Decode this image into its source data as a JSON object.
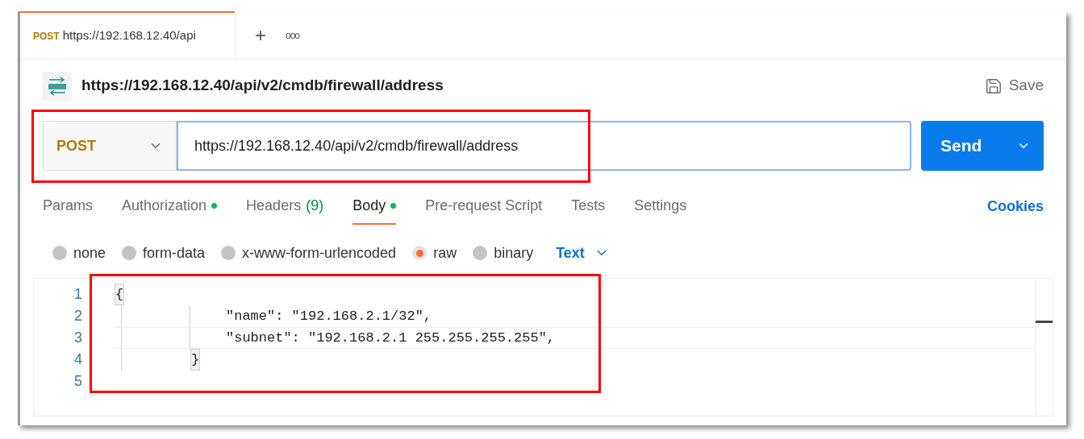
{
  "tab": {
    "method": "POST",
    "url": "https://192.168.12.40/api",
    "selected": true
  },
  "tab_actions": [
    "+",
    "ooo"
  ],
  "request": {
    "title": "https://192.168.12.40/api/v2/cmdb/firewall/address",
    "save": "Save"
  },
  "url_bar": {
    "method": "POST",
    "url": "https://192.168.12.40/api/v2/cmdb/firewall/address",
    "send": "Send",
    "highlighted": true
  },
  "request_tabs": [
    {
      "label": "Params",
      "selected": false,
      "dot": false
    },
    {
      "label": "Authorization",
      "selected": false,
      "dot": true
    },
    {
      "label": "Headers",
      "count": "(9)",
      "selected": false,
      "dot": false
    },
    {
      "label": "Body",
      "selected": true,
      "dot": true
    },
    {
      "label": "Pre-request Script",
      "selected": false,
      "dot": false
    },
    {
      "label": "Tests",
      "selected": false,
      "dot": false
    },
    {
      "label": "Settings",
      "selected": false,
      "dot": false
    }
  ],
  "cookies": "Cookies",
  "body_types": [
    {
      "label": "none",
      "selected": false
    },
    {
      "label": "form-data",
      "selected": false
    },
    {
      "label": "x-www-form-urlencoded",
      "selected": false
    },
    {
      "label": "raw",
      "selected": true
    },
    {
      "label": "binary",
      "selected": false
    }
  ],
  "format": "Text",
  "editor": {
    "highlighted": true,
    "lines": [
      {
        "number": "1",
        "text": "{",
        "kind": "open"
      },
      {
        "number": "2",
        "text": "\"name\": \"192.168.2.1/32\",",
        "kind": "entry"
      },
      {
        "number": "3",
        "text": "\"subnet\": \"192.168.2.1 255.255.255.255\",",
        "kind": "entry"
      },
      {
        "number": "4",
        "text": "}",
        "kind": "close"
      },
      {
        "number": "5",
        "kind": "blank"
      }
    ]
  }
}
